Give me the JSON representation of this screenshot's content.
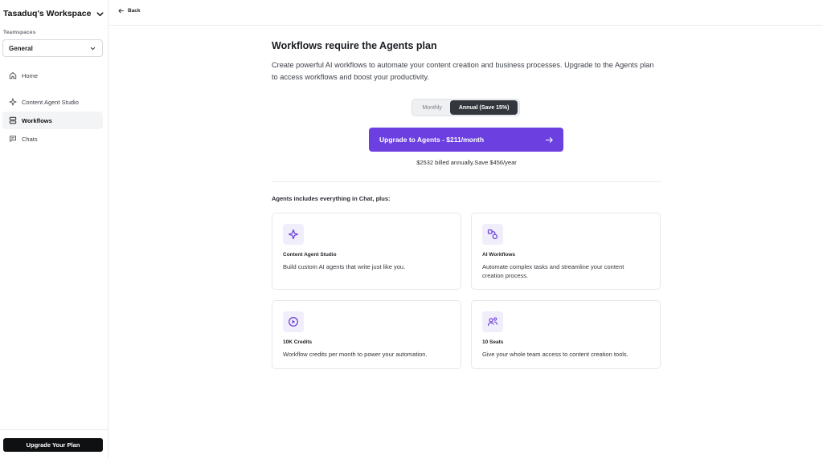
{
  "sidebar": {
    "workspace_title": "Tasaduq's Workspace",
    "teamspaces_label": "Teamspaces",
    "teamspace_selected": "General",
    "nav_items": [
      {
        "label": "Home",
        "icon": "home-icon"
      },
      {
        "label": "Content Agent Studio",
        "icon": "sparkle-icon"
      },
      {
        "label": "Workflows",
        "icon": "workflow-icon",
        "active": true
      },
      {
        "label": "Chats",
        "icon": "chat-icon"
      }
    ],
    "upgrade_button_label": "Upgrade Your Plan"
  },
  "topbar": {
    "back_label": "Back"
  },
  "main": {
    "title": "Workflows require the Agents plan",
    "description": "Create powerful AI workflows to automate your content creation and business processes. Upgrade to the Agents plan to access workflows and boost your productivity.",
    "billing_toggle": {
      "monthly_label": "Monthly",
      "annual_label": "Annual (Save 15%)",
      "selected": "Annual (Save 15%)"
    },
    "upgrade_button_label": "Upgrade to Agents - $211/month",
    "billing_note": "$2532 billed annually.Save $456/year",
    "features_heading": "Agents includes everything in Chat, plus:",
    "features": [
      {
        "title": "Content Agent Studio",
        "description": "Build custom AI agents that write just like you.",
        "icon": "sparkle-icon"
      },
      {
        "title": "AI Workflows",
        "description": "Automate complex tasks and streamline your content creation process.",
        "icon": "workflow-nodes-icon"
      },
      {
        "title": "10K Credits",
        "description": "Workflow credits per month to power your automation.",
        "icon": "credits-icon"
      },
      {
        "title": "10 Seats",
        "description": "Give your whole team access to content creation tools.",
        "icon": "team-icon"
      }
    ]
  },
  "colors": {
    "accent": "#6b3fe0",
    "accent_icon": "#6d45d9",
    "icon_bg": "#f1eefc",
    "dark_button": "#0f1011",
    "toggle_active": "#33373d"
  }
}
